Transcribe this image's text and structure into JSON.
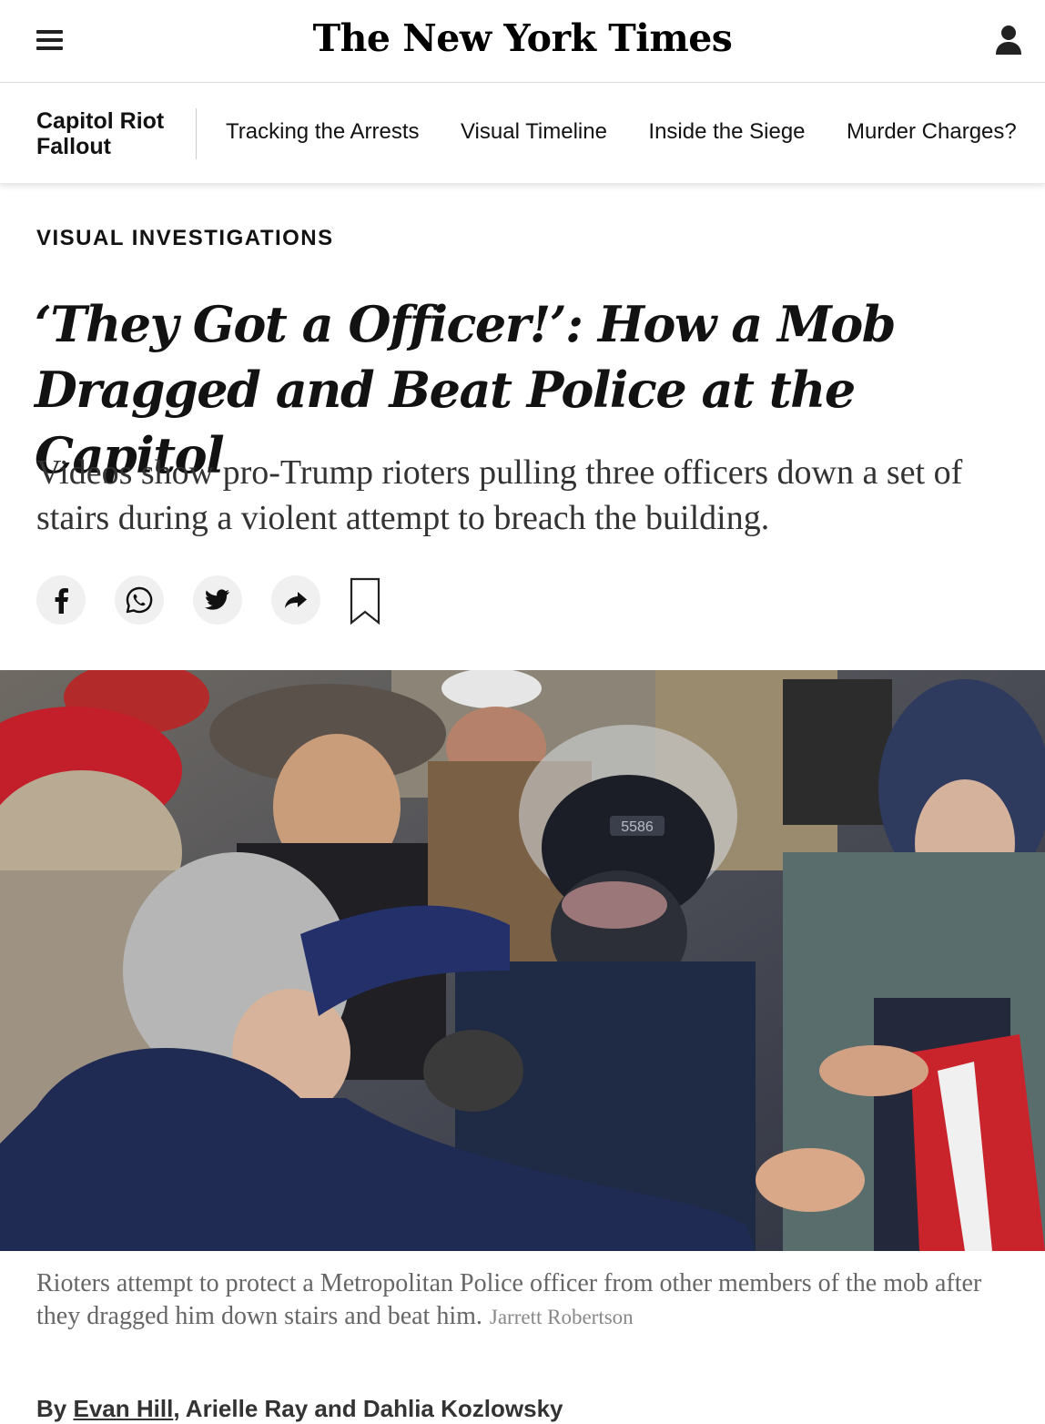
{
  "header": {
    "masthead": "The New York Times",
    "menu_icon": "hamburger-menu-icon",
    "account_icon": "user-account-icon"
  },
  "subnav": {
    "section_label": "Capitol Riot Fallout",
    "links": [
      "Tracking the Arrests",
      "Visual Timeline",
      "Inside the Siege",
      "Murder Charges?"
    ]
  },
  "article": {
    "kicker": "VISUAL INVESTIGATIONS",
    "headline": "‘They Got a Officer!’: How a Mob Dragged and Beat Police at the Capitol",
    "dek": "Videos show pro-Trump rioters pulling three officers down a set of stairs during a violent attempt to breach the building.",
    "share_buttons": [
      "facebook-icon",
      "whatsapp-icon",
      "twitter-icon",
      "share-arrow-icon",
      "bookmark-icon"
    ],
    "image": {
      "helmet_number": "5586"
    },
    "caption": "Rioters attempt to protect a Metropolitan Police officer from other members of the mob after they dragged him down stairs and beat him.",
    "credit": "Jarrett Robertson",
    "byline_prefix": "By",
    "byline_author_1": "Evan Hill",
    "byline_rest": ", Arielle Ray and Dahlia Kozlowsky"
  }
}
